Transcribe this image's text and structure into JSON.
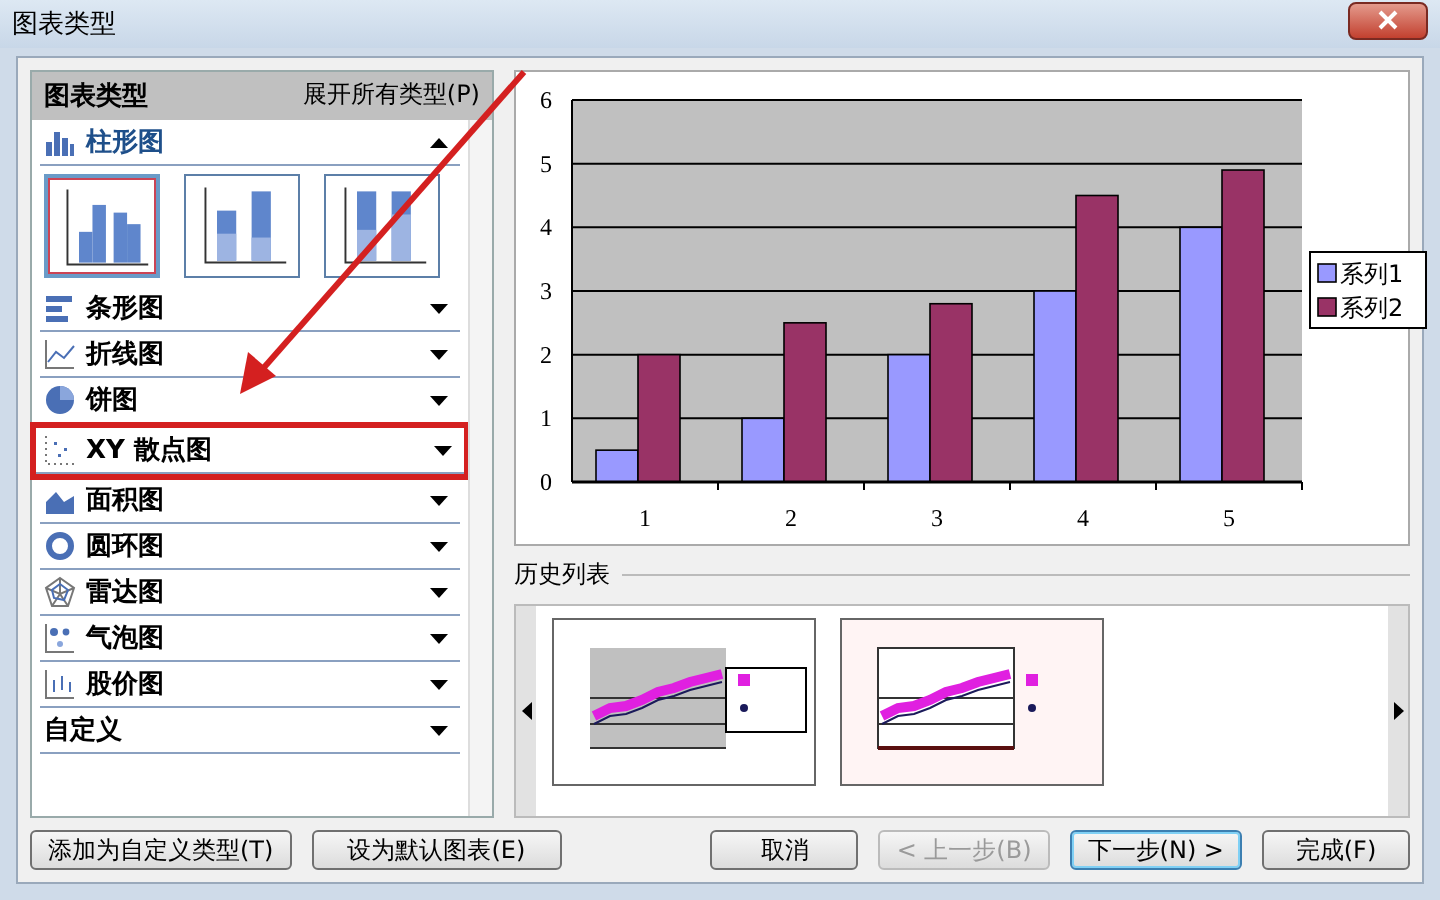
{
  "window": {
    "title": "图表类型"
  },
  "type_panel": {
    "title": "图表类型",
    "expand_all": "展开所有类型(P)",
    "subtypes": [
      {
        "selected": true
      },
      {
        "selected": false
      },
      {
        "selected": false
      }
    ],
    "types": [
      {
        "label": "柱形图",
        "expanded": true,
        "highlighted": false
      },
      {
        "label": "条形图",
        "expanded": false,
        "highlighted": false
      },
      {
        "label": "折线图",
        "expanded": false,
        "highlighted": false
      },
      {
        "label": "饼图",
        "expanded": false,
        "highlighted": false
      },
      {
        "label": "XY 散点图",
        "expanded": false,
        "highlighted": true
      },
      {
        "label": "面积图",
        "expanded": false,
        "highlighted": false
      },
      {
        "label": "圆环图",
        "expanded": false,
        "highlighted": false
      },
      {
        "label": "雷达图",
        "expanded": false,
        "highlighted": false
      },
      {
        "label": "气泡图",
        "expanded": false,
        "highlighted": false
      },
      {
        "label": "股价图",
        "expanded": false,
        "highlighted": false
      },
      {
        "label": "自定义",
        "expanded": false,
        "highlighted": false
      }
    ]
  },
  "preview": {
    "chart_data": {
      "type": "bar",
      "grid": true,
      "legend": true,
      "categories": [
        "1",
        "2",
        "3",
        "4",
        "5"
      ],
      "yticks": [
        0,
        1,
        2,
        3,
        4,
        5,
        6
      ],
      "ylim": [
        0,
        6
      ],
      "series": [
        {
          "name": "系列1",
          "color": "#9999ff",
          "values": [
            0.5,
            1,
            2,
            3,
            4
          ]
        },
        {
          "name": "系列2",
          "color": "#993366",
          "values": [
            2,
            2.5,
            2.8,
            4.5,
            4.9
          ]
        }
      ]
    }
  },
  "history": {
    "title": "历史列表",
    "items": [
      {
        "kind": "shaded"
      },
      {
        "kind": "tinted"
      }
    ]
  },
  "buttons": [
    {
      "label": "添加为自定义类型(T)",
      "disabled": false,
      "default": false
    },
    {
      "label": "设为默认图表(E)",
      "disabled": false,
      "default": false
    },
    {
      "label": "取消",
      "disabled": false,
      "default": false
    },
    {
      "label": "< 上一步(B)",
      "disabled": true,
      "default": false
    },
    {
      "label": "下一步(N) >",
      "disabled": false,
      "default": true
    },
    {
      "label": "完成(F)",
      "disabled": false,
      "default": false
    }
  ]
}
